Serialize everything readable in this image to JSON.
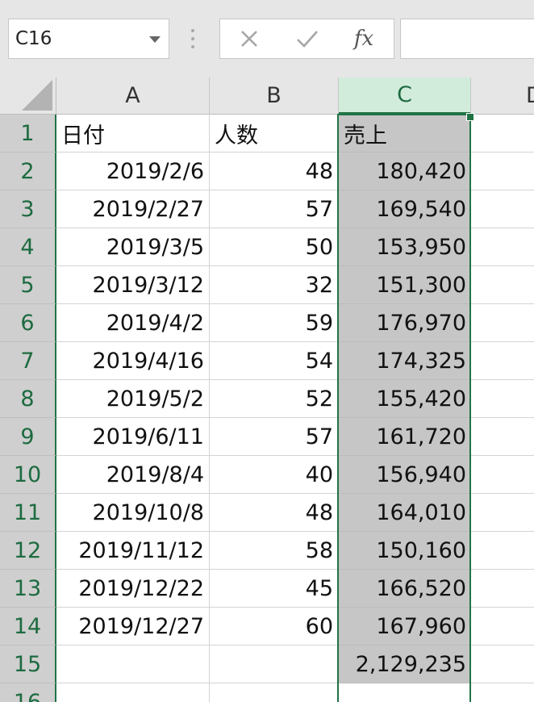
{
  "name_box": {
    "value": "C16"
  },
  "formula_bar": {
    "fx_label": "fx",
    "value": ""
  },
  "columns": [
    "A",
    "B",
    "C",
    "D"
  ],
  "selected_column": "C",
  "rows": [
    {
      "num": "1",
      "a": "日付",
      "b": "人数",
      "c": "売上"
    },
    {
      "num": "2",
      "a": "2019/2/6",
      "b": "48",
      "c": "180,420"
    },
    {
      "num": "3",
      "a": "2019/2/27",
      "b": "57",
      "c": "169,540"
    },
    {
      "num": "4",
      "a": "2019/3/5",
      "b": "50",
      "c": "153,950"
    },
    {
      "num": "5",
      "a": "2019/3/12",
      "b": "32",
      "c": "151,300"
    },
    {
      "num": "6",
      "a": "2019/4/2",
      "b": "59",
      "c": "176,970"
    },
    {
      "num": "7",
      "a": "2019/4/16",
      "b": "54",
      "c": "174,325"
    },
    {
      "num": "8",
      "a": "2019/5/2",
      "b": "52",
      "c": "155,420"
    },
    {
      "num": "9",
      "a": "2019/6/11",
      "b": "57",
      "c": "161,720"
    },
    {
      "num": "10",
      "a": "2019/8/4",
      "b": "40",
      "c": "156,940"
    },
    {
      "num": "11",
      "a": "2019/10/8",
      "b": "48",
      "c": "164,010"
    },
    {
      "num": "12",
      "a": "2019/11/12",
      "b": "58",
      "c": "150,160"
    },
    {
      "num": "13",
      "a": "2019/12/22",
      "b": "45",
      "c": "166,520"
    },
    {
      "num": "14",
      "a": "2019/12/27",
      "b": "60",
      "c": "167,960"
    },
    {
      "num": "15",
      "a": "",
      "b": "",
      "c": "2,129,235"
    },
    {
      "num": "16",
      "a": "",
      "b": "",
      "c": ""
    }
  ],
  "colors": {
    "accent": "#217346",
    "selected_fill": "#c6c6c6",
    "header_selected": "#d2ecdb"
  }
}
